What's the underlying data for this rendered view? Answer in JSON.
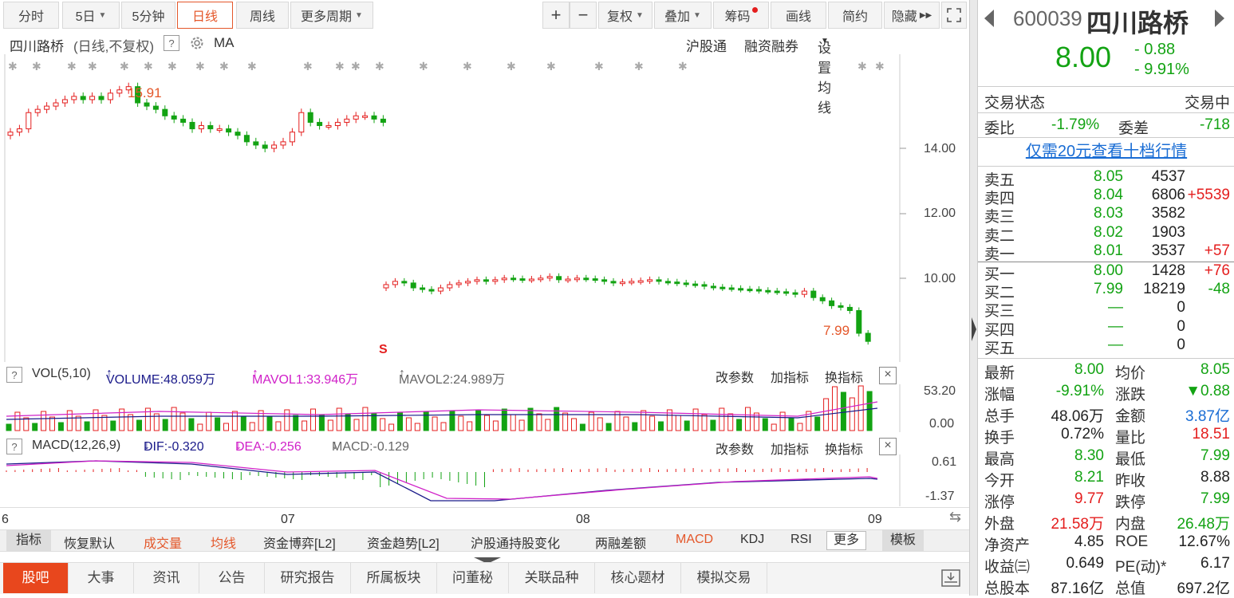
{
  "toolbar": {
    "period_tabs": [
      "分时",
      "5日",
      "5分钟",
      "日线",
      "周线",
      "更多周期"
    ],
    "active_period": "日线",
    "tools": [
      "复权",
      "叠加",
      "筹码",
      "画线",
      "简约",
      "隐藏"
    ],
    "plus": "+",
    "minus": "−"
  },
  "title": {
    "stock": "四川路桥",
    "mode": "(日线,不复权)",
    "help": "?",
    "indicator": "MA",
    "links": [
      "沪股通",
      "融资融券",
      "设置均线"
    ]
  },
  "price_axis": [
    "14.00",
    "12.00",
    "10.00"
  ],
  "annotations": {
    "high": "15.91",
    "low": "7.99",
    "marker": "S"
  },
  "vol_panel": {
    "help": "?",
    "label": "VOL(5,10)",
    "volume": "VOLUME:48.059万",
    "mavol1": "MAVOL1:33.946万",
    "mavol2": "MAVOL2:24.989万",
    "actions": [
      "改参数",
      "加指标",
      "换指标"
    ],
    "close": "×",
    "axis": [
      "53.20",
      "0.00"
    ]
  },
  "macd_panel": {
    "help": "?",
    "label": "MACD(12,26,9)",
    "dif": "DIF:-0.320",
    "dea": "DEA:-0.256",
    "macd": "MACD:-0.129",
    "actions": [
      "改参数",
      "加指标",
      "换指标"
    ],
    "close": "×",
    "axis": [
      "0.61",
      "-1.37"
    ]
  },
  "date_axis": [
    "6",
    "07",
    "08",
    "09"
  ],
  "indicator_tabs": [
    "指标",
    "恢复默认",
    "成交量",
    "均线",
    "资金博弈[L2]",
    "资金趋势[L2]",
    "沪股通持股变化",
    "两融差额",
    "MACD",
    "KDJ",
    "RSI",
    "更多",
    "模板"
  ],
  "bottom_tabs": [
    "股吧",
    "大事",
    "资讯",
    "公告",
    "研究报告",
    "所属板块",
    "问董秘",
    "关联品种",
    "核心题材",
    "模拟交易"
  ],
  "quote": {
    "code": "600039",
    "name": "四川路桥",
    "price": "8.00",
    "change": "- 0.88",
    "change_pct": "- 9.91%",
    "status_label": "交易状态",
    "status": "交易中",
    "wb_label": "委比",
    "wb": "-1.79%",
    "wc_label": "委差",
    "wc": "-718",
    "promo": "仅需20元查看十档行情",
    "asks": [
      {
        "label": "卖五",
        "price": "8.05",
        "vol": "4537",
        "delta": ""
      },
      {
        "label": "卖四",
        "price": "8.04",
        "vol": "6806",
        "delta": "+5539"
      },
      {
        "label": "卖三",
        "price": "8.03",
        "vol": "3582",
        "delta": ""
      },
      {
        "label": "卖二",
        "price": "8.02",
        "vol": "1903",
        "delta": ""
      },
      {
        "label": "卖一",
        "price": "8.01",
        "vol": "3537",
        "delta": "+57"
      }
    ],
    "bids": [
      {
        "label": "买一",
        "price": "8.00",
        "vol": "1428",
        "delta": "+76"
      },
      {
        "label": "买二",
        "price": "7.99",
        "vol": "18219",
        "delta": "-48"
      },
      {
        "label": "买三",
        "price": "—",
        "vol": "0",
        "delta": ""
      },
      {
        "label": "买四",
        "price": "—",
        "vol": "0",
        "delta": ""
      },
      {
        "label": "买五",
        "price": "—",
        "vol": "0",
        "delta": ""
      }
    ],
    "stats": [
      {
        "l1": "最新",
        "v1": "8.00",
        "l2": "均价",
        "v2": "8.05"
      },
      {
        "l1": "涨幅",
        "v1": "-9.91%",
        "l2": "涨跌",
        "v2": "▼0.88"
      },
      {
        "l1": "总手",
        "v1": "48.06万",
        "l2": "金额",
        "v2": "3.87亿"
      },
      {
        "l1": "换手",
        "v1": "0.72%",
        "l2": "量比",
        "v2": "18.51"
      },
      {
        "l1": "最高",
        "v1": "8.30",
        "l2": "最低",
        "v2": "7.99"
      },
      {
        "l1": "今开",
        "v1": "8.21",
        "l2": "昨收",
        "v2": "8.88"
      },
      {
        "l1": "涨停",
        "v1": "9.77",
        "l2": "跌停",
        "v2": "7.99"
      },
      {
        "l1": "外盘",
        "v1": "21.58万",
        "l2": "内盘",
        "v2": "26.48万"
      },
      {
        "l1": "净资产",
        "v1": "4.85",
        "l2": "ROE",
        "v2": "12.67%"
      },
      {
        "l1": "收益㈢",
        "v1": "0.649",
        "l2": "PE(动)*",
        "v2": "6.17"
      },
      {
        "l1": "总股本",
        "v1": "87.16亿",
        "l2": "总值",
        "v2": "697.2亿"
      }
    ]
  },
  "colors": {
    "up": "#e41e1e",
    "down": "#13a313",
    "accent": "#e8471d",
    "link": "#1a6dd4"
  }
}
